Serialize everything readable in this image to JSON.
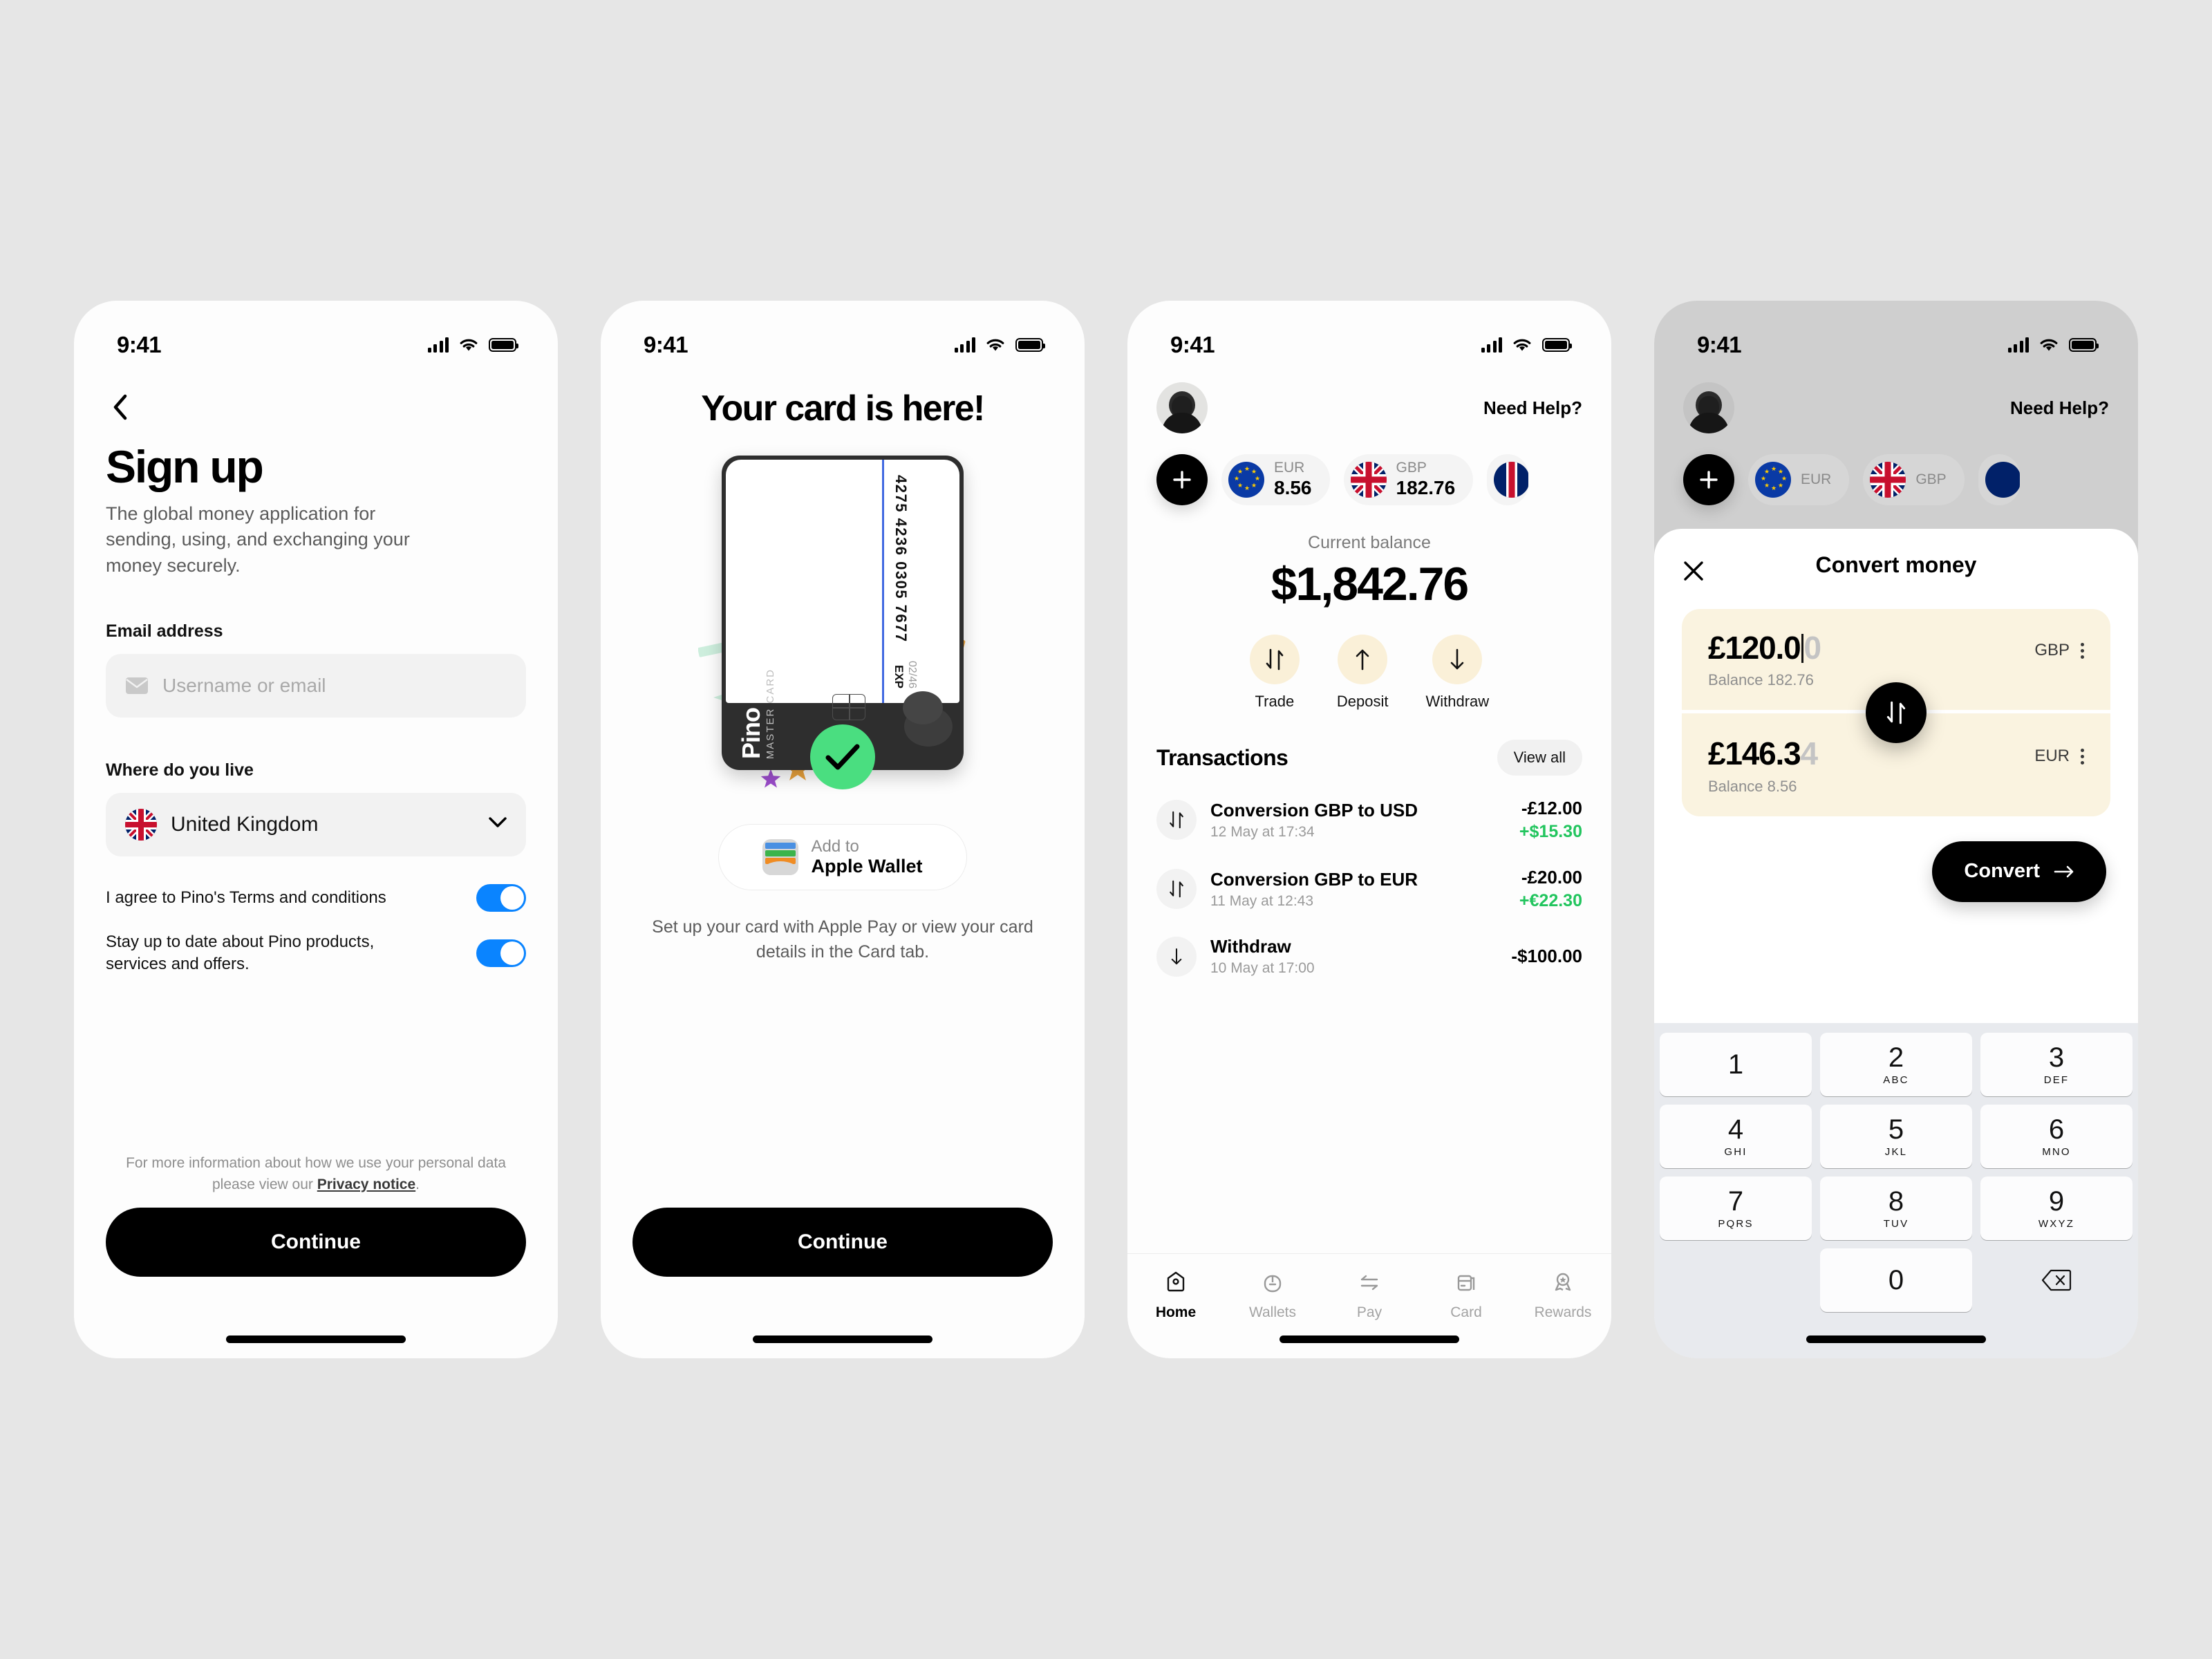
{
  "status_bar": {
    "time": "9:41"
  },
  "screen1": {
    "title": "Sign up",
    "subtitle": "The global money application for sending, using, and exchanging your money securely.",
    "email_label": "Email address",
    "email_placeholder": "Username or email",
    "country_label": "Where do you live",
    "country_value": "United Kingdom",
    "toggle_terms": "I agree to Pino's Terms and conditions",
    "toggle_marketing": "Stay up to date about Pino products, services and offers.",
    "legal_prefix": "For more information about how we use your personal data please view our ",
    "legal_link": "Privacy notice",
    "legal_suffix": ".",
    "cta": "Continue"
  },
  "screen2": {
    "title": "Your card is here!",
    "card_number": "4275 4236 0305 7677",
    "card_exp_label": "EXP",
    "card_exp_value": "02/46",
    "card_brand": "Pino",
    "card_network": "MASTER CARD",
    "wallet_line1": "Add to",
    "wallet_line2": "Apple Wallet",
    "note": "Set up your card with Apple Pay or view your card details in the Card tab.",
    "cta": "Continue"
  },
  "screen3": {
    "need_help": "Need Help?",
    "add_label": "+",
    "wallets": [
      {
        "code": "EUR",
        "amount": "8.56"
      },
      {
        "code": "GBP",
        "amount": "182.76"
      }
    ],
    "balance_label": "Current balance",
    "balance_amount": "$1,842.76",
    "actions": [
      {
        "label": "Trade",
        "icon": "swap-vertical-icon"
      },
      {
        "label": "Deposit",
        "icon": "arrow-up-icon"
      },
      {
        "label": "Withdraw",
        "icon": "arrow-down-icon"
      }
    ],
    "transactions_title": "Transactions",
    "view_all": "View all",
    "transactions": [
      {
        "name": "Conversion GBP to USD",
        "date": "12 May at 17:34",
        "primary": "-£12.00",
        "secondary": "+$15.30",
        "icon": "swap-vertical-icon"
      },
      {
        "name": "Conversion GBP to EUR",
        "date": "11 May at 12:43",
        "primary": "-£20.00",
        "secondary": "+€22.30",
        "icon": "swap-vertical-icon"
      },
      {
        "name": "Withdraw",
        "date": "10 May at 17:00",
        "primary": "-$100.00",
        "secondary": "",
        "icon": "arrow-down-icon"
      }
    ],
    "tabs": [
      {
        "label": "Home",
        "icon": "home-icon",
        "active": true
      },
      {
        "label": "Wallets",
        "icon": "wallet-icon",
        "active": false
      },
      {
        "label": "Pay",
        "icon": "transfer-icon",
        "active": false
      },
      {
        "label": "Card",
        "icon": "card-icon",
        "active": false
      },
      {
        "label": "Rewards",
        "icon": "award-icon",
        "active": false
      }
    ]
  },
  "screen4": {
    "need_help": "Need Help?",
    "wallets": [
      {
        "code": "EUR"
      },
      {
        "code": "GBP"
      }
    ],
    "sheet_title": "Convert money",
    "from": {
      "amount_typed": "£120.0",
      "amount_ghost": "0",
      "balance": "Balance 182.76",
      "currency": "GBP"
    },
    "to": {
      "amount_typed": "£146.3",
      "amount_ghost": "4",
      "balance": "Balance 8.56",
      "currency": "EUR"
    },
    "convert_label": "Convert",
    "keypad": [
      {
        "num": "1",
        "ltr": ""
      },
      {
        "num": "2",
        "ltr": "ABC"
      },
      {
        "num": "3",
        "ltr": "DEF"
      },
      {
        "num": "4",
        "ltr": "GHI"
      },
      {
        "num": "5",
        "ltr": "JKL"
      },
      {
        "num": "6",
        "ltr": "MNO"
      },
      {
        "num": "7",
        "ltr": "PQRS"
      },
      {
        "num": "8",
        "ltr": "TUV"
      },
      {
        "num": "9",
        "ltr": "WXYZ"
      },
      {
        "num": "0",
        "ltr": ""
      }
    ]
  },
  "colors": {
    "background": "#e6e6e6",
    "accent_blue": "#0a84ff",
    "accent_green": "#22c55e",
    "cream": "#faf3e0",
    "black": "#000000"
  }
}
